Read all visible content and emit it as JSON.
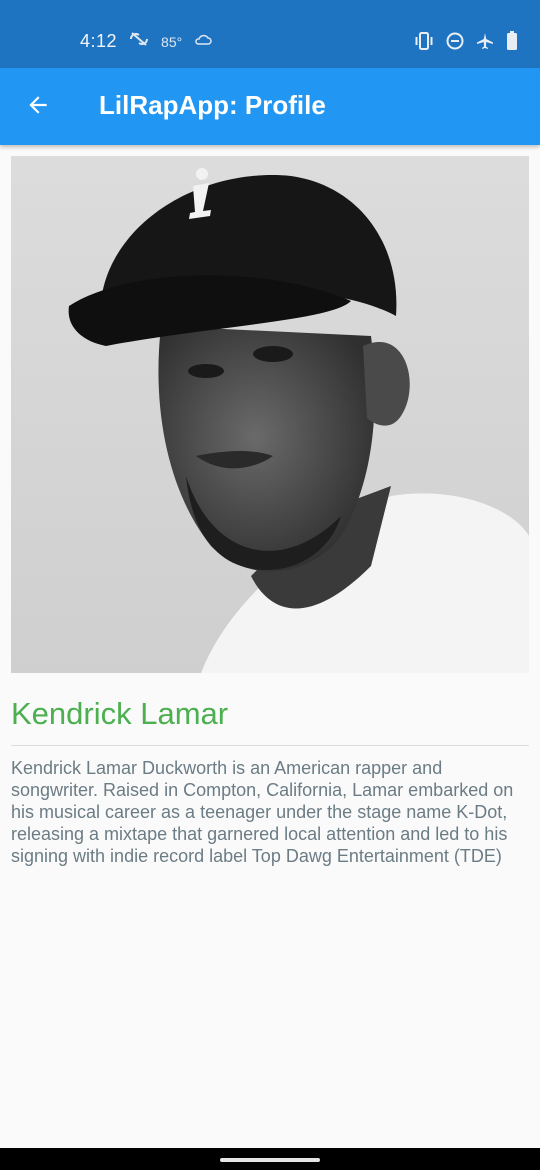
{
  "status_bar": {
    "time": "4:12",
    "temperature": "85°",
    "icons": [
      "sync-off-icon",
      "cloud-icon",
      "vibrate-icon",
      "do-not-disturb-icon",
      "airplane-icon",
      "battery-icon"
    ]
  },
  "app_bar": {
    "title": "LilRapApp: Profile",
    "back_icon": "arrow-back-icon",
    "background": "#2196f3"
  },
  "profile": {
    "name": "Kendrick Lamar",
    "name_color": "#4caf50",
    "bio": "Kendrick Lamar Duckworth is an American rapper and songwriter. Raised in Compton, California, Lamar embarked on his musical career as a teenager under the stage name K-Dot, releasing a mixtape that garnered local attention and led to his signing with indie record label Top Dawg Entertainment (TDE)"
  }
}
